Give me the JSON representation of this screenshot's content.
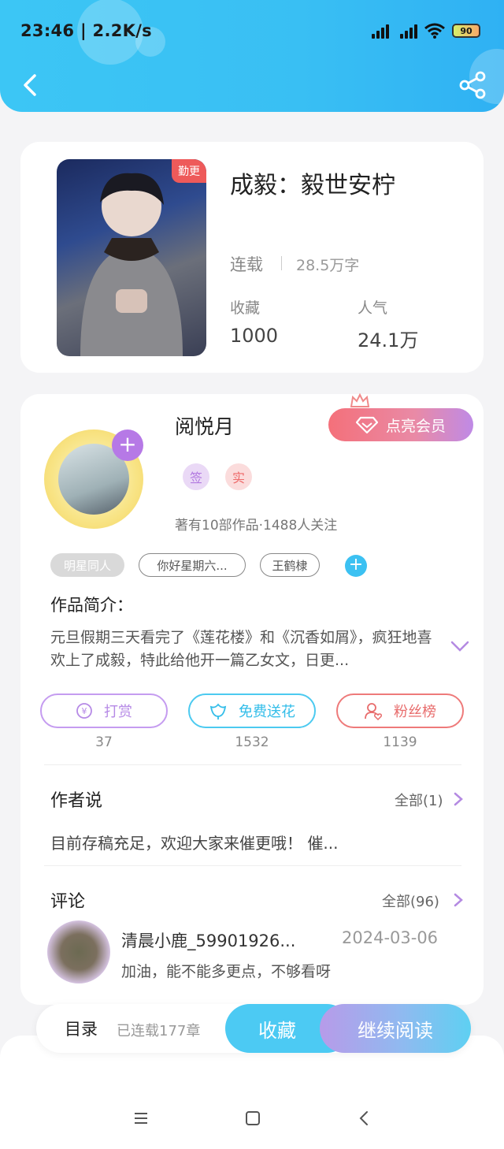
{
  "status_bar": {
    "time": "23:46 | 2.2K/s",
    "battery": "90",
    "icons": [
      "hd-signal-icon",
      "hd-signal-icon",
      "wifi-icon",
      "battery-icon"
    ]
  },
  "header": {
    "back_icon": "chevron-left-icon",
    "share_icon": "share-icon",
    "color": "#3cc6f5"
  },
  "book": {
    "badge": "勤更",
    "title": "成毅：毅世安柠",
    "status": "连载",
    "words": "28.5万字",
    "stats": [
      {
        "label": "收藏",
        "value": "1000"
      },
      {
        "label": "人气",
        "value": "24.1万"
      }
    ]
  },
  "author": {
    "name": "阅悦月",
    "vip_label": "点亮会员",
    "badges": [
      {
        "text": "签",
        "color": "#b279e0"
      },
      {
        "text": "实",
        "color": "#ee6a6a"
      }
    ],
    "meta": "著有10部作品·1488人关注",
    "tags": [
      "明星同人",
      "你好星期六...",
      "王鹤棣"
    ],
    "intro_label": "作品简介：",
    "intro_text": "元旦假期三天看完了《莲花楼》和《沉香如屑》，疯狂地喜欢上了成毅，特此给他开一篇乙女文，日更..."
  },
  "actions": [
    {
      "label": "打赏",
      "count": "37",
      "color": "#b68ae6",
      "icon": "coin-icon"
    },
    {
      "label": "免费送花",
      "count": "1532",
      "color": "#4ccaf0",
      "icon": "flower-icon"
    },
    {
      "label": "粉丝榜",
      "count": "1139",
      "color": "#ee7a7a",
      "icon": "fan-icon"
    }
  ],
  "author_say": {
    "title": "作者说",
    "more": "全部(1)",
    "text": "目前存稿充足，欢迎大家来催更哦！ 催..."
  },
  "comments": {
    "title": "评论",
    "more": "全部(96)",
    "items": [
      {
        "user": "清晨小鹿_59901926...",
        "date": "2024-03-06",
        "text": "加油，能不能多更点，不够看呀"
      }
    ]
  },
  "bottom_bar": {
    "toc_label": "目录",
    "chapters": "已连载177章",
    "collect_label": "收藏",
    "read_label": "继续阅读"
  },
  "nav": {
    "icons": [
      "menu-icon",
      "home-square-icon",
      "back-triangle-icon"
    ]
  }
}
